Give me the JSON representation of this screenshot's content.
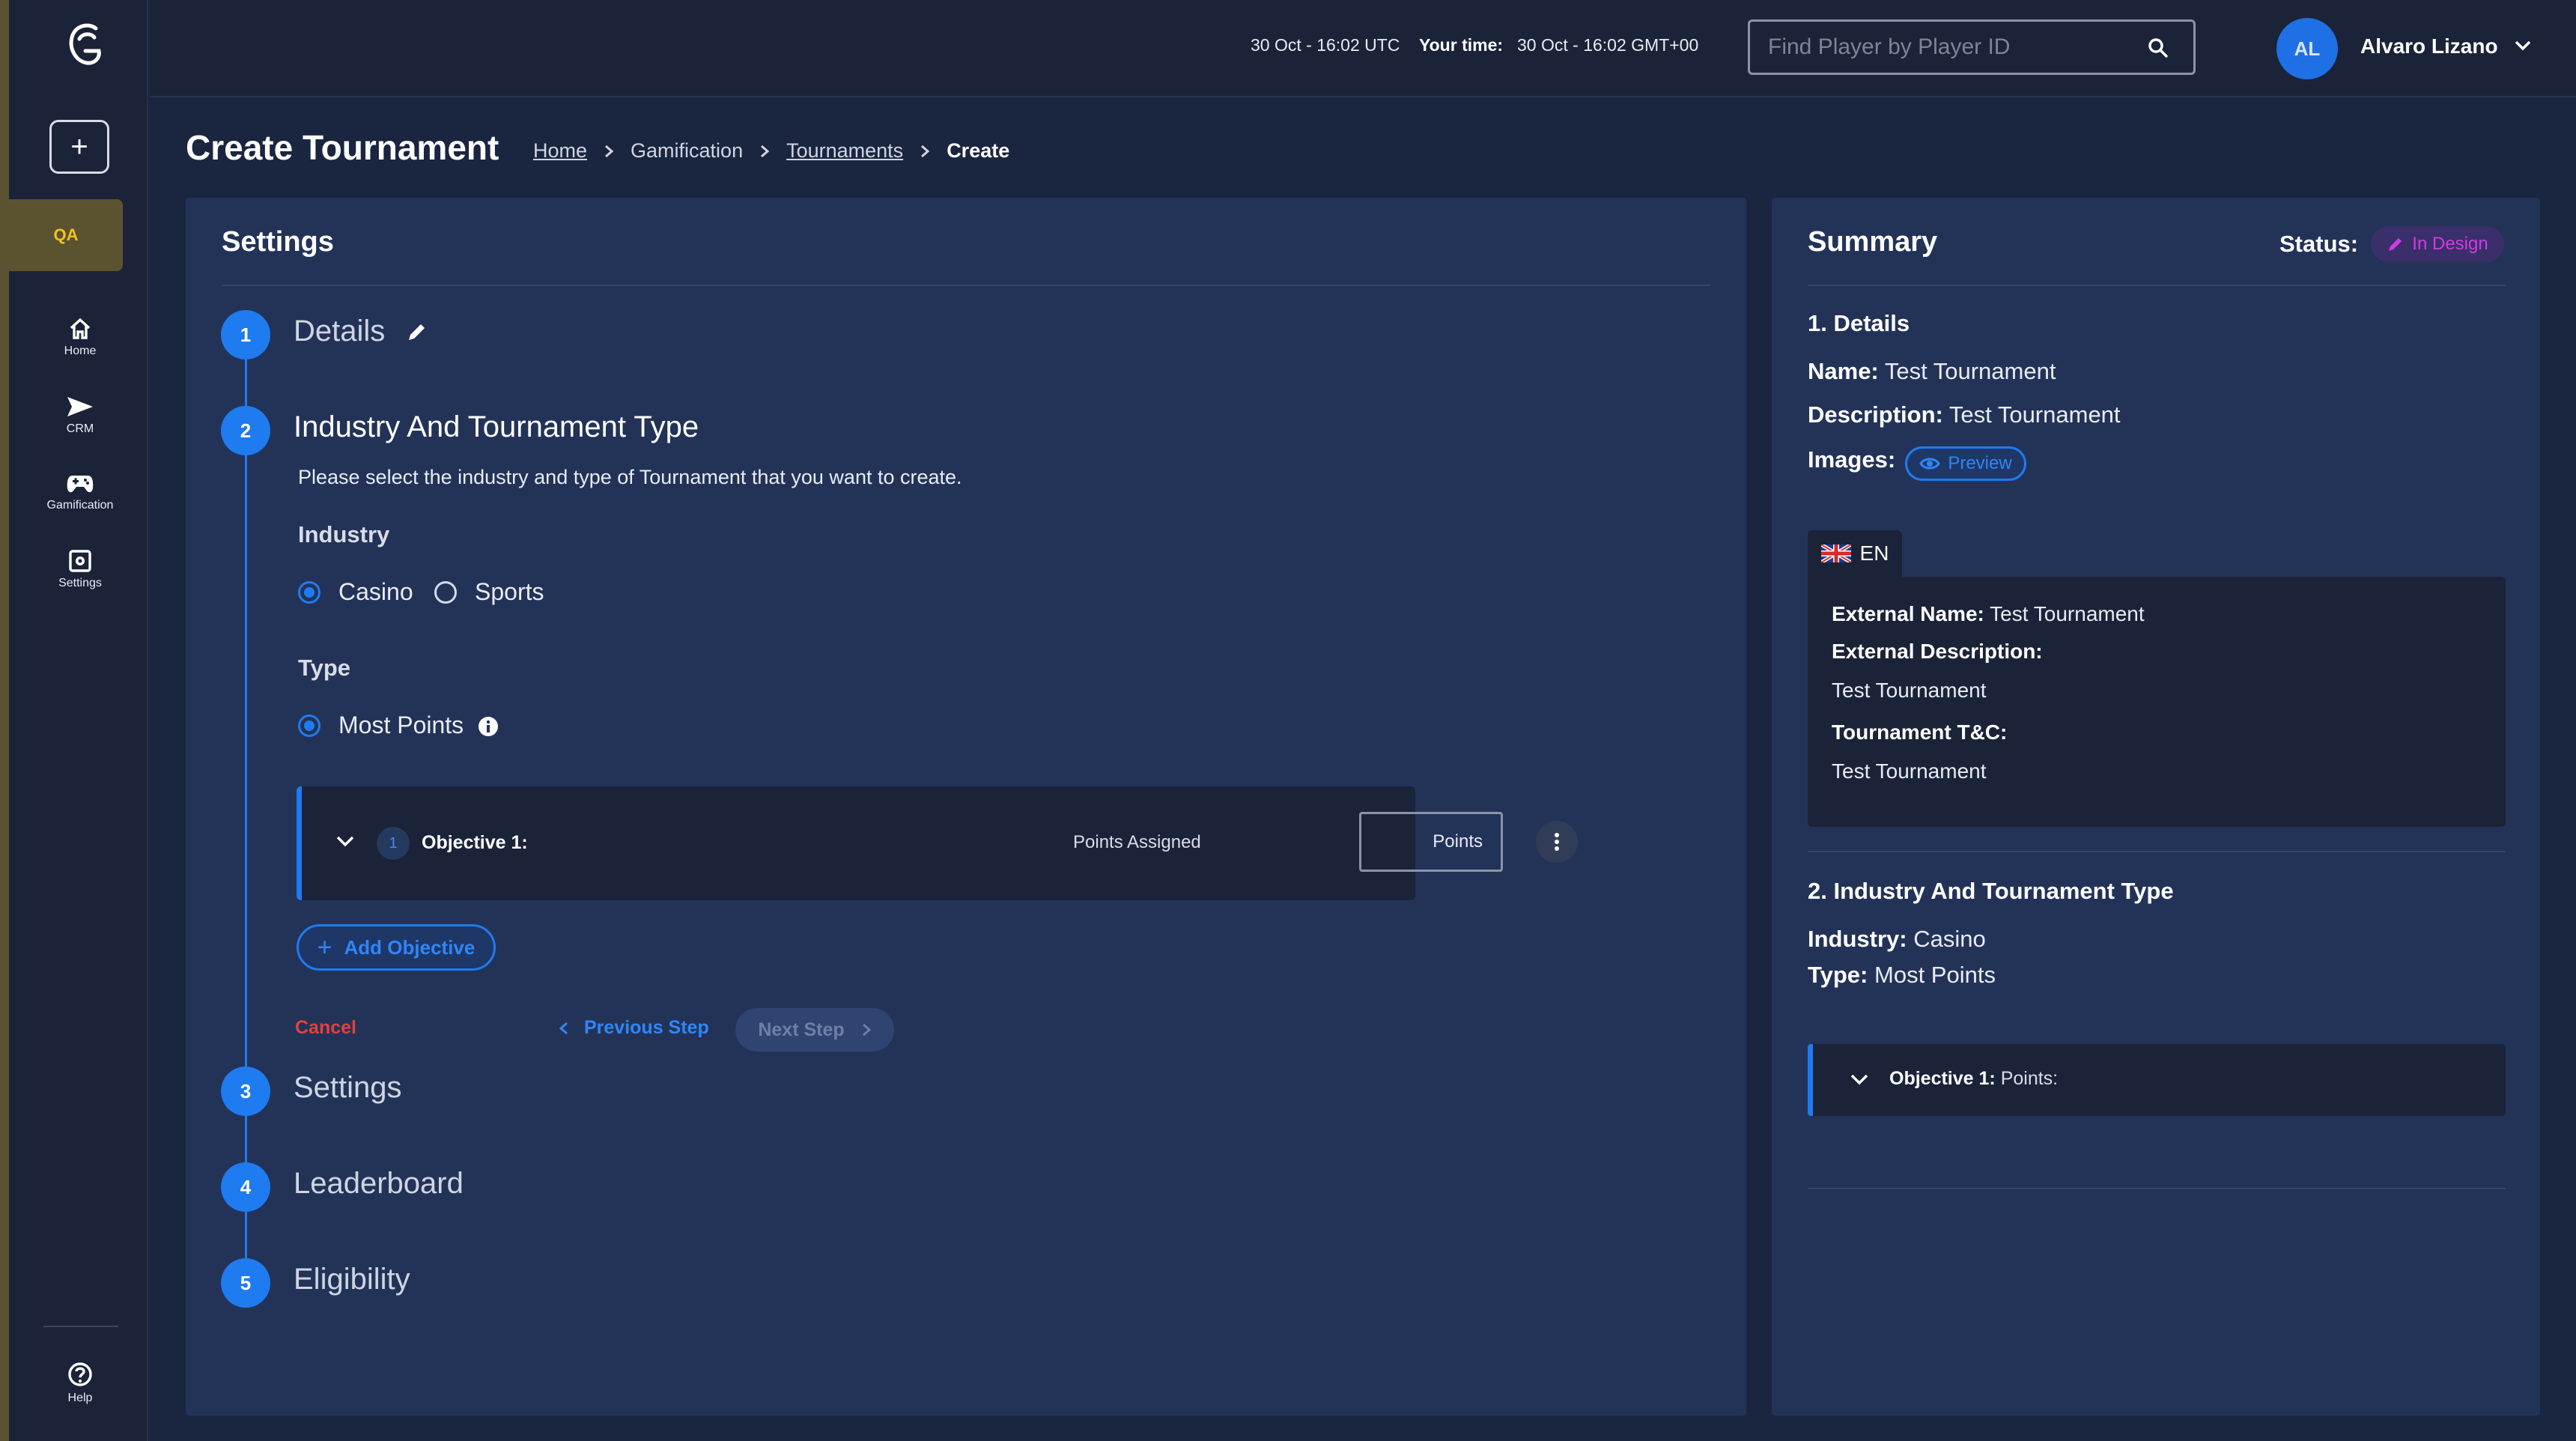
{
  "sidebar": {
    "env_badge": "QA",
    "items": [
      {
        "label": "Home",
        "icon": "home-icon"
      },
      {
        "label": "CRM",
        "icon": "send-icon"
      },
      {
        "label": "Gamification",
        "icon": "gamepad-icon"
      },
      {
        "label": "Settings",
        "icon": "gear-icon"
      }
    ],
    "help_label": "Help"
  },
  "topbar": {
    "utc_time": "30 Oct - 16:02 UTC",
    "your_time_label": "Your time:",
    "your_time": "30 Oct - 16:02 GMT+00",
    "search_placeholder": "Find Player by Player ID",
    "avatar_initials": "AL",
    "user_name": "Alvaro Lizano"
  },
  "page": {
    "title": "Create Tournament",
    "breadcrumb": [
      "Home",
      "Gamification",
      "Tournaments",
      "Create"
    ]
  },
  "settings": {
    "title": "Settings",
    "steps": [
      {
        "num": "1",
        "title": "Details"
      },
      {
        "num": "2",
        "title": "Industry And Tournament Type"
      },
      {
        "num": "3",
        "title": "Settings"
      },
      {
        "num": "4",
        "title": "Leaderboard"
      },
      {
        "num": "5",
        "title": "Eligibility"
      }
    ],
    "instructions": "Please select the industry and type of Tournament that you want to create.",
    "industry_label": "Industry",
    "industry_options": [
      "Casino",
      "Sports"
    ],
    "industry_selected": "Casino",
    "type_label": "Type",
    "type_options": [
      "Most Points"
    ],
    "objective": {
      "number": "1",
      "title": "Objective 1:",
      "points_label": "Points Assigned",
      "points_placeholder": "Points"
    },
    "add_objective": "Add Objective",
    "cancel": "Cancel",
    "previous": "Previous Step",
    "next": "Next Step"
  },
  "summary": {
    "title": "Summary",
    "status_label": "Status:",
    "status_value": "In Design",
    "details_heading": "1. Details",
    "name_label": "Name:",
    "name_value": "Test Tournament",
    "description_label": "Description:",
    "description_value": "Test Tournament",
    "images_label": "Images:",
    "preview": "Preview",
    "lang": "EN",
    "external_name_label": "External Name:",
    "external_name_value": "Test Tournament",
    "external_description_label": "External Description:",
    "external_description_value": "Test Tournament",
    "tc_label": "Tournament T&C:",
    "tc_value": "Test Tournament",
    "industry_heading": "2. Industry And Tournament Type",
    "industry_label": "Industry:",
    "industry_value": "Casino",
    "type_label": "Type:",
    "type_value": "Most Points",
    "objective_label": "Objective 1:",
    "objective_value": "Points:"
  },
  "colors": {
    "accent": "#1f7bf0",
    "cancel": "#e0413f",
    "status": "#d13ce0",
    "env_badge": "#f1c41a"
  }
}
